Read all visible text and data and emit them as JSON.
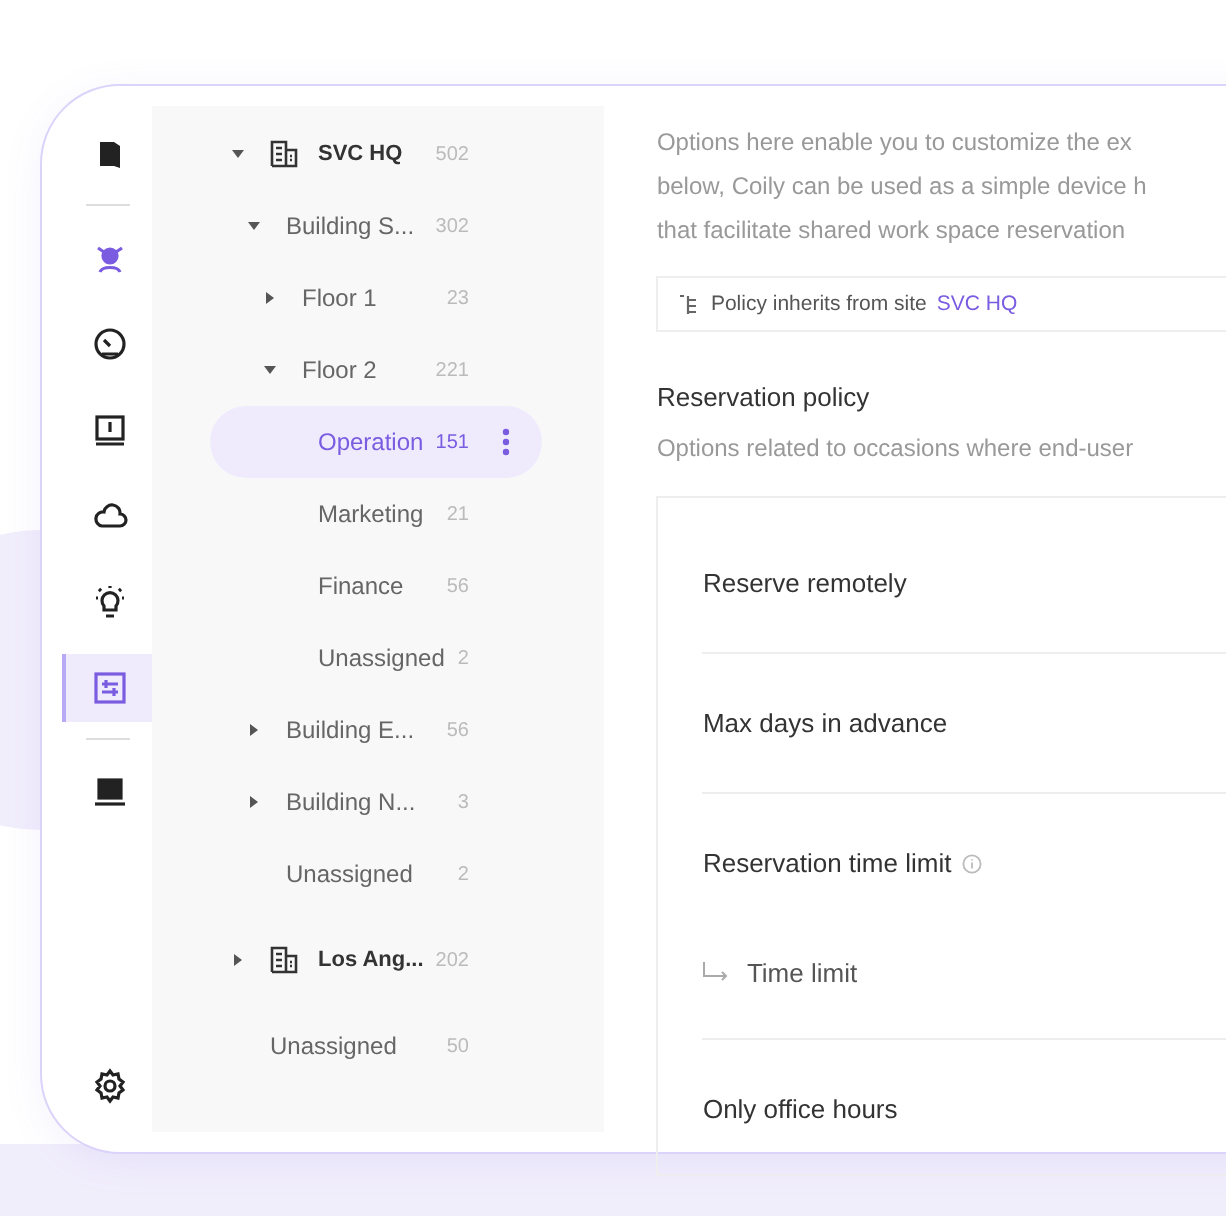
{
  "rail": [
    {
      "selected": false
    },
    {
      "selected": false
    },
    {
      "selected": false
    },
    {
      "selected": false
    },
    {
      "selected": false
    },
    {
      "selected": false
    },
    {
      "selected": true
    },
    {
      "selected": false
    },
    {
      "selected": false
    }
  ],
  "tree": [
    {
      "label": "SVC HQ",
      "count": "502",
      "kind": "site",
      "expanded": true,
      "selected": false,
      "children": [
        {
          "label": "Building S...",
          "count": "302",
          "kind": "area",
          "expanded": true,
          "selected": false,
          "children": [
            {
              "label": "Floor 1",
              "count": "23",
              "kind": "area",
              "expanded": false,
              "selected": false
            },
            {
              "label": "Floor 2",
              "count": "221",
              "kind": "area",
              "expanded": true,
              "selected": false,
              "children": [
                {
                  "label": "Operation",
                  "count": "151",
                  "kind": "area",
                  "selected": true
                },
                {
                  "label": "Marketing",
                  "count": "21",
                  "kind": "area",
                  "selected": false
                },
                {
                  "label": "Finance",
                  "count": "56",
                  "kind": "area",
                  "selected": false
                },
                {
                  "label": "Unassigned",
                  "count": "2",
                  "kind": "area",
                  "selected": false
                }
              ]
            }
          ]
        },
        {
          "label": "Building E...",
          "count": "56",
          "kind": "area",
          "expanded": false,
          "selected": false
        },
        {
          "label": "Building N...",
          "count": "3",
          "kind": "area",
          "expanded": false,
          "selected": false
        },
        {
          "label": "Unassigned",
          "count": "2",
          "kind": "area",
          "selected": false
        }
      ]
    },
    {
      "label": "Los Ang...",
      "count": "202",
      "kind": "site",
      "expanded": false,
      "selected": false
    },
    {
      "label": "Unassigned",
      "count": "50",
      "kind": "area",
      "selected": false
    }
  ],
  "content": {
    "intro_lines": [
      "Options here enable you to customize the ex",
      "below, Coily can be used as a simple device h",
      "that facilitate shared work space reservation"
    ],
    "inherit": {
      "text": "Policy inherits from site",
      "link": "SVC HQ"
    },
    "section": {
      "title": "Reservation policy",
      "subtitle": "Options related to occasions where end-user"
    },
    "settings": [
      {
        "kind": "setting",
        "label": "Reserve remotely"
      },
      {
        "kind": "setting",
        "label": "Max days in advance"
      },
      {
        "kind": "info-setting",
        "label": "Reservation time limit"
      },
      {
        "kind": "sub",
        "label": "Time limit"
      },
      {
        "kind": "setting",
        "label": "Only office hours"
      }
    ]
  }
}
